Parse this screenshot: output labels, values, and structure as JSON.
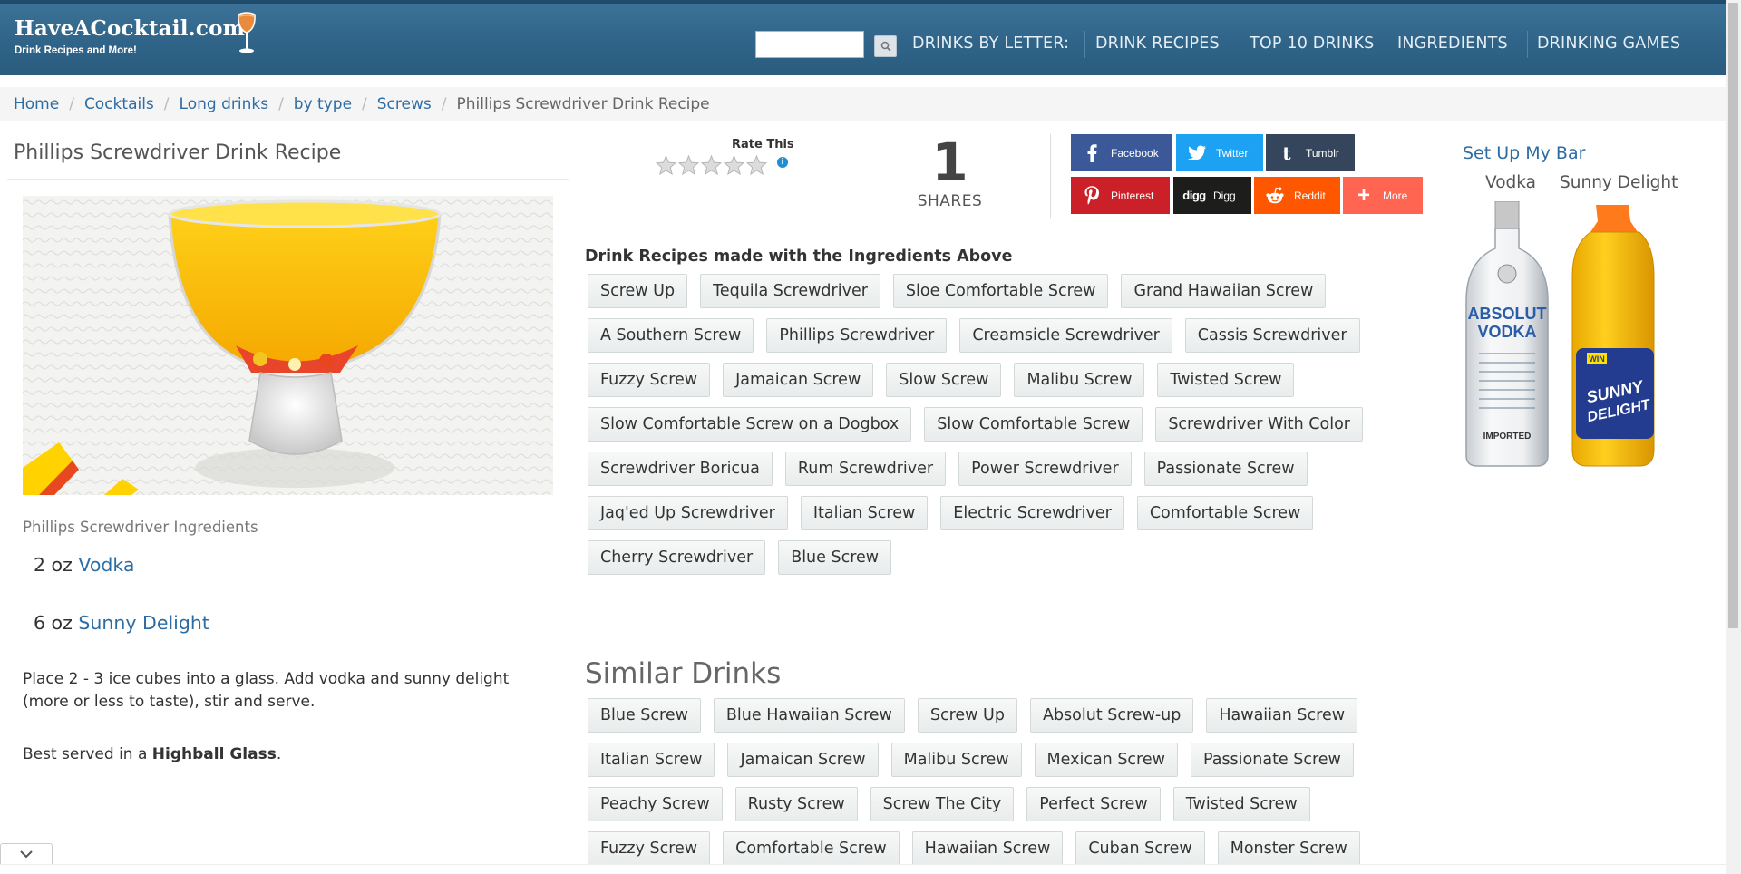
{
  "header": {
    "logo_title": "HaveACocktail.com",
    "logo_subtitle": "Drink Recipes and More!",
    "search_placeholder": "",
    "nav": [
      "DRINKS BY LETTER:",
      "DRINK RECIPES",
      "TOP 10 DRINKS",
      "INGREDIENTS",
      "DRINKING GAMES"
    ]
  },
  "breadcrumb": {
    "items": [
      "Home",
      "Cocktails",
      "Long drinks",
      "by type",
      "Screws"
    ],
    "current": "Phillips Screwdriver Drink Recipe"
  },
  "recipe": {
    "title": "Phillips Screwdriver Drink Recipe",
    "ingredients_heading": "Phillips Screwdriver Ingredients",
    "ingredients": [
      {
        "amount": "2 oz",
        "name": "Vodka"
      },
      {
        "amount": "6 oz",
        "name": "Sunny Delight"
      }
    ],
    "instructions": "Place 2 - 3 ice cubes into a glass. Add vodka and sunny delight (more or less to taste), stir and serve.",
    "served_prefix": "Best served in a",
    "glass": "Highball Glass",
    "served_suffix": "."
  },
  "rating": {
    "label": "Rate This",
    "stars": 5,
    "info": "i"
  },
  "shares": {
    "count": "1",
    "label": "SHARES"
  },
  "share_buttons": [
    {
      "name": "Facebook",
      "color": "#3b5998",
      "icon": "facebook-icon"
    },
    {
      "name": "Twitter",
      "color": "#1da1f2",
      "icon": "twitter-icon"
    },
    {
      "name": "Tumblr",
      "color": "#35465c",
      "icon": "tumblr-icon"
    },
    {
      "name": "Pinterest",
      "color": "#cb2027",
      "icon": "pinterest-icon"
    },
    {
      "name": "Digg",
      "color": "#1d1d1b",
      "icon": "digg-icon"
    },
    {
      "name": "Reddit",
      "color": "#ff5700",
      "icon": "reddit-icon"
    },
    {
      "name": "More",
      "color": "#ff6550",
      "icon": "plus-icon"
    }
  ],
  "ingredient_drinks": {
    "heading": "Drink Recipes made with the Ingredients Above",
    "items": [
      "Screw Up",
      "Tequila Screwdriver",
      "Sloe Comfortable Screw",
      "Grand Hawaiian Screw",
      "A Southern Screw",
      "Phillips Screwdriver",
      "Creamsicle Screwdriver",
      "Cassis Screwdriver",
      "Fuzzy Screw",
      "Jamaican Screw",
      "Slow Screw",
      "Malibu Screw",
      "Twisted Screw",
      "Slow Comfortable Screw on a Dogbox",
      "Slow Comfortable Screw",
      "Screwdriver With Color",
      "Screwdriver Boricua",
      "Rum Screwdriver",
      "Power Screwdriver",
      "Passionate Screw",
      "Jaq'ed Up Screwdriver",
      "Italian Screw",
      "Electric Screwdriver",
      "Comfortable Screw",
      "Cherry Screwdriver",
      "Blue Screw"
    ]
  },
  "similar_drinks": {
    "heading": "Similar Drinks",
    "items": [
      "Blue Screw",
      "Blue Hawaiian Screw",
      "Screw Up",
      "Absolut Screw-up",
      "Hawaiian Screw",
      "Italian Screw",
      "Jamaican Screw",
      "Malibu Screw",
      "Mexican Screw",
      "Passionate Screw",
      "Peachy Screw",
      "Rusty Screw",
      "Screw The City",
      "Perfect Screw",
      "Twisted Screw",
      "Fuzzy Screw",
      "Comfortable Screw",
      "Hawaiian Screw",
      "Cuban Screw",
      "Monster Screw"
    ]
  },
  "my_bar": {
    "title": "Set Up My Bar",
    "items": [
      "Vodka",
      "Sunny Delight"
    ],
    "vodka_label_brand": "ABSOLUT",
    "vodka_label_product": "VODKA",
    "vodka_label_origin": "IMPORTED",
    "sunny_label_badge": "WIN",
    "sunny_label_brand_1": "SUNNY",
    "sunny_label_brand_2": "DELIGHT"
  }
}
